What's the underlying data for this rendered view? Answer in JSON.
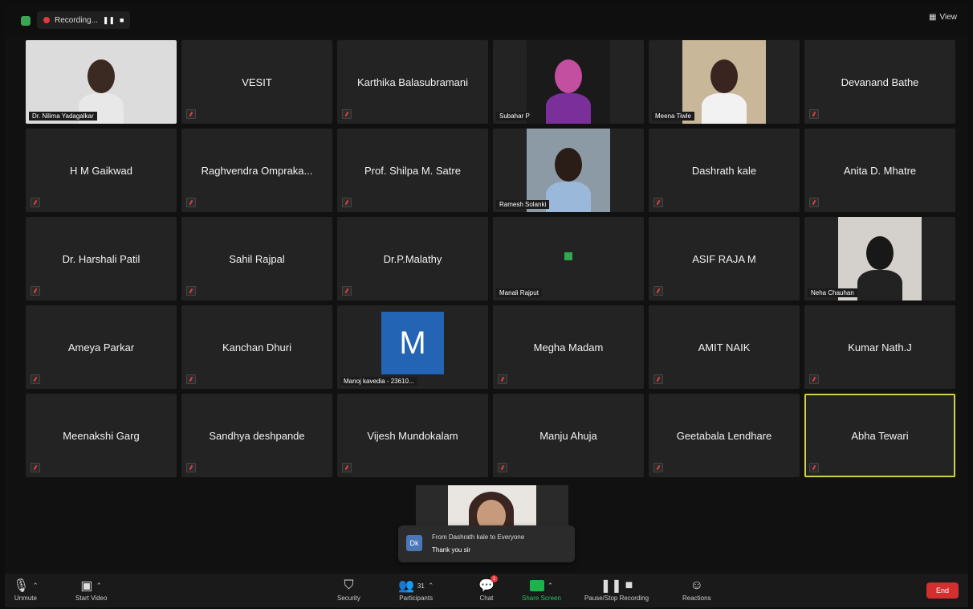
{
  "topbar": {
    "recording_label": "Recording...",
    "pause_icon": "pause-icon",
    "stop_icon": "stop-icon",
    "view_label": "View"
  },
  "participants": [
    {
      "name": "Dr. Nilima Yadagalkar",
      "video": true
    },
    {
      "name": "VESIT"
    },
    {
      "name": "Karthika Balasubramani"
    },
    {
      "name": "Subahar P",
      "video": true
    },
    {
      "name": "Meena Tiwle",
      "video": true
    },
    {
      "name": "Devanand Bathe"
    },
    {
      "name": "H M Gaikwad"
    },
    {
      "name": "Raghvendra Omprakа..."
    },
    {
      "name": "Prof. Shilpa M. Satre"
    },
    {
      "name": "Ramesh Solanki",
      "video": true
    },
    {
      "name": "Dashrath kale"
    },
    {
      "name": "Anita D. Mhatre"
    },
    {
      "name": "Dr. Harshali Patil"
    },
    {
      "name": "Sahil Rajpal"
    },
    {
      "name": "Dr.P.Malathy"
    },
    {
      "name": "Manali Rajput",
      "video": true
    },
    {
      "name": "ASIF RAJA M"
    },
    {
      "name": "Neha Chauhan",
      "video": true
    },
    {
      "name": "Ameya Parkar"
    },
    {
      "name": "Kanchan Dhuri"
    },
    {
      "name": "Manoj kavedia - 23610...",
      "avatar": "M"
    },
    {
      "name": "Megha Madam"
    },
    {
      "name": "AMIT NAIK"
    },
    {
      "name": "Kumar Nath.J"
    },
    {
      "name": "Meenakshi Garg"
    },
    {
      "name": "Sandhya deshpande"
    },
    {
      "name": "Vijesh Mundokalam"
    },
    {
      "name": "Manju Ahuja"
    },
    {
      "name": "Geetabala Lendhare"
    },
    {
      "name": "Abha Tewari",
      "active": true
    }
  ],
  "chat_popup": {
    "avatar_initials": "Dk",
    "from": "From Dashrath kale to Everyone",
    "message": "Thank you sir"
  },
  "toolbar": {
    "unmute": "Unmute",
    "start_video": "Start Video",
    "security": "Security",
    "participants": "Participants",
    "participants_count": "31",
    "chat": "Chat",
    "chat_badge": "1",
    "share_screen": "Share Screen",
    "pause_stop_recording": "Pause/Stop Recording",
    "reactions": "Reactions",
    "end": "End"
  },
  "colors": {
    "tile_bg": "#232323",
    "active_border": "#cfcf4a",
    "share_green": "#1fb14c",
    "end_red": "#d32f2f",
    "avatar_blue": "#2464b4"
  }
}
